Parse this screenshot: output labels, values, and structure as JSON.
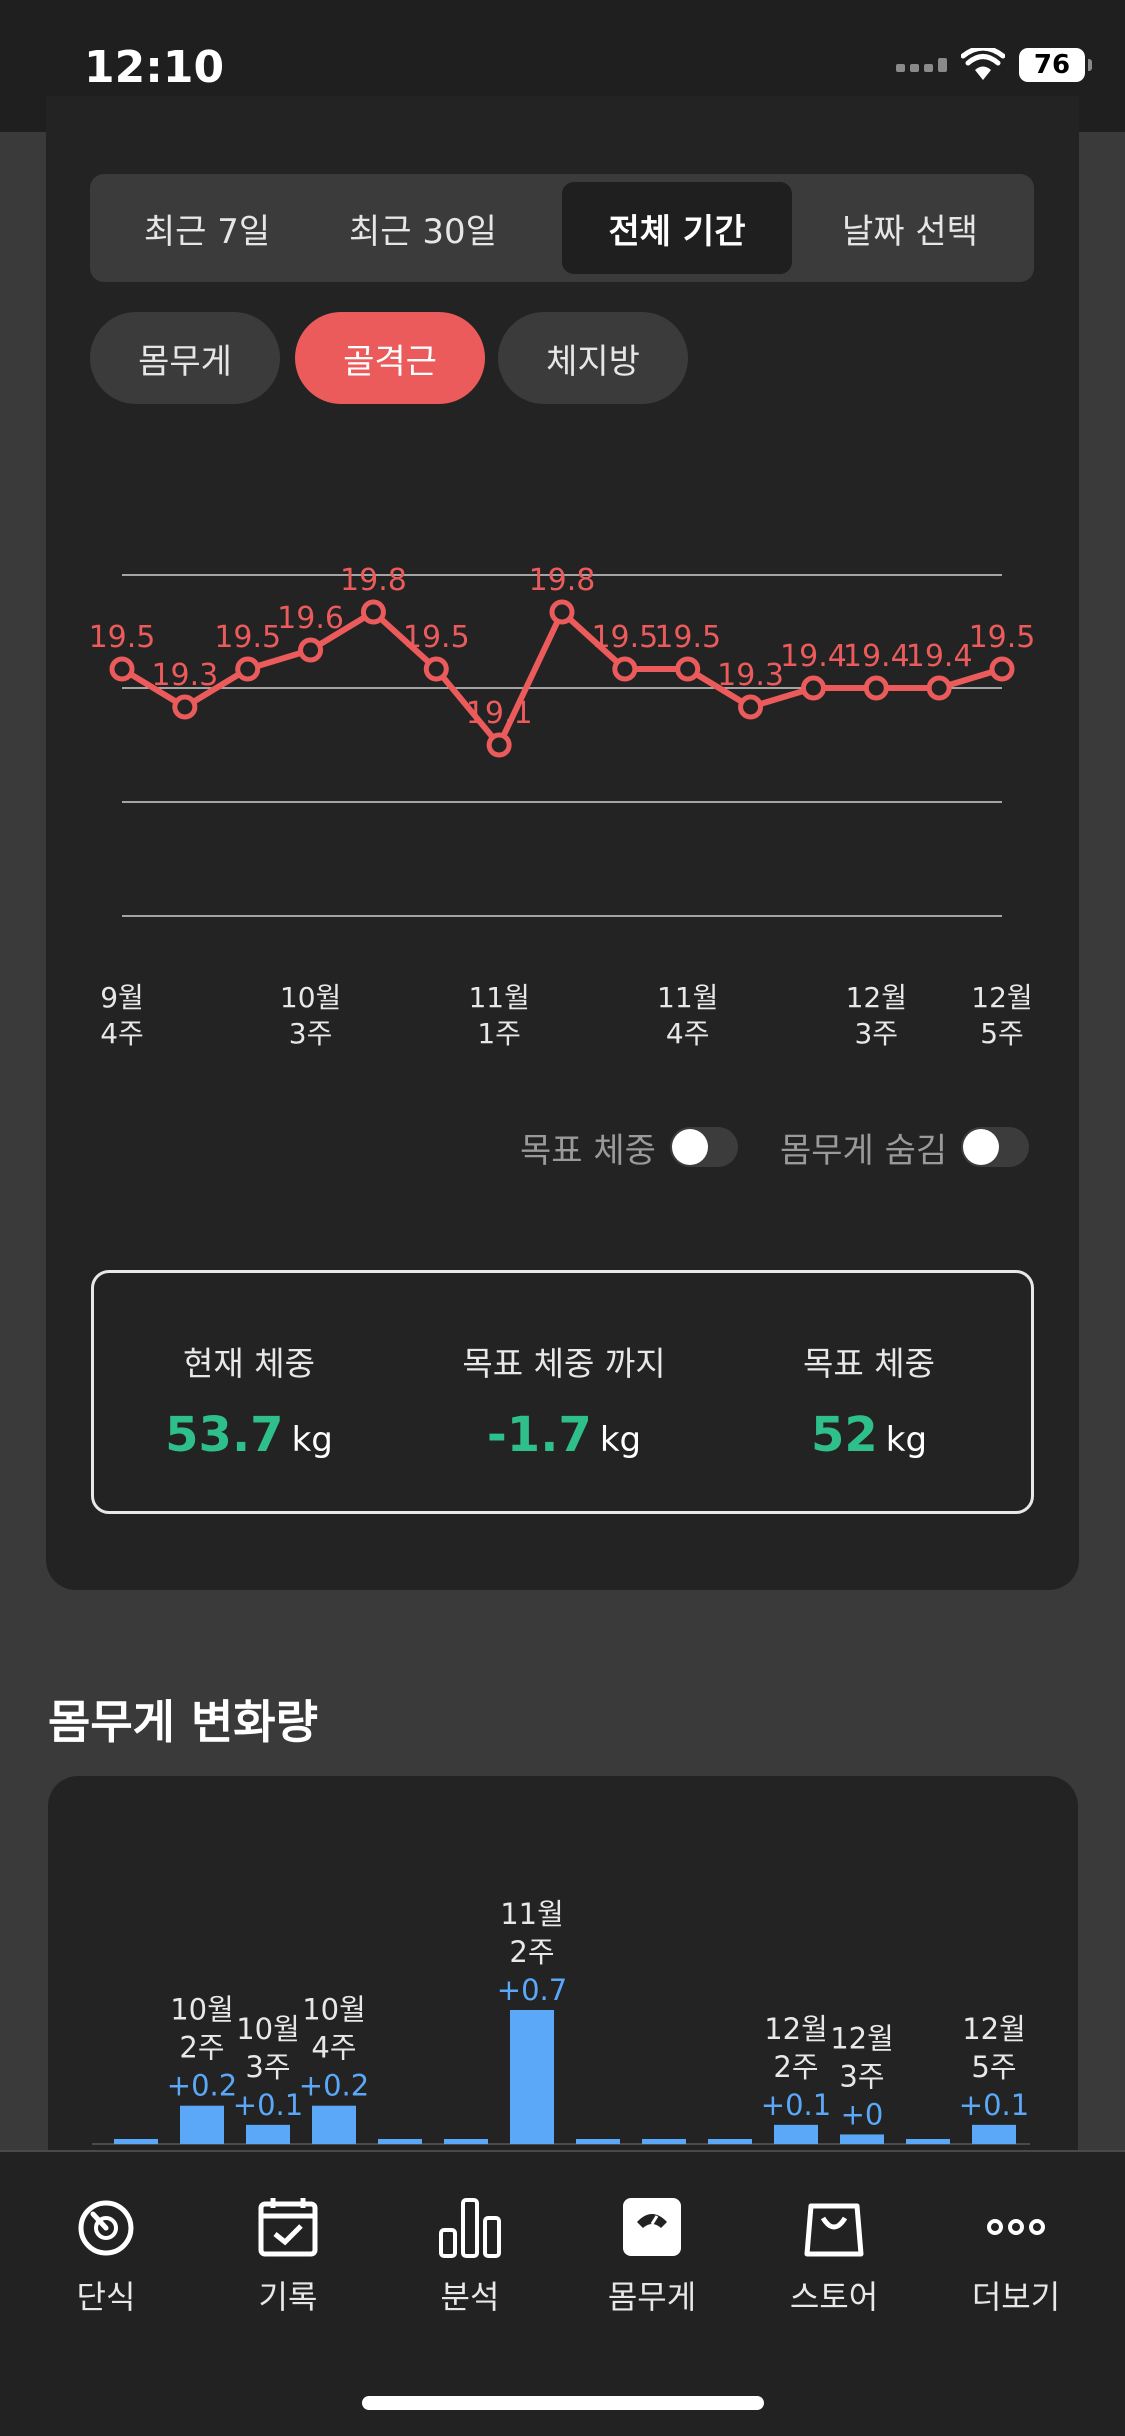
{
  "status_bar": {
    "time": "12:10",
    "battery": "76"
  },
  "period_tabs": [
    {
      "label": "최근 7일",
      "active": false
    },
    {
      "label": "최근 30일",
      "active": false
    },
    {
      "label": "전체 기간",
      "active": true
    },
    {
      "label": "날짜 선택",
      "active": false
    }
  ],
  "metric_chips": [
    {
      "label": "몸무게",
      "active": false
    },
    {
      "label": "골격근",
      "active": true
    },
    {
      "label": "체지방",
      "active": false
    }
  ],
  "chart_data": [
    {
      "type": "line",
      "title": "",
      "xlabel": "",
      "ylabel": "",
      "grid": true,
      "ylim": [
        18.2,
        20.0
      ],
      "x": [
        "9월 4주",
        "",
        "10월 3주",
        "",
        "",
        "11월 1주",
        "",
        "",
        "11월 4주",
        "",
        "",
        "12월 3주",
        "",
        "12월 5주",
        ""
      ],
      "tick_labels": [
        {
          "index": 0,
          "line1": "9월",
          "line2": "4주"
        },
        {
          "index": 3,
          "line1": "10월",
          "line2": "3주"
        },
        {
          "index": 6,
          "line1": "11월",
          "line2": "1주"
        },
        {
          "index": 9,
          "line1": "11월",
          "line2": "4주"
        },
        {
          "index": 12,
          "line1": "12월",
          "line2": "3주"
        },
        {
          "index": 14,
          "line1": "12월",
          "line2": "5주"
        }
      ],
      "series": [
        {
          "color": "#ec5b5b",
          "values": [
            19.5,
            19.3,
            19.5,
            19.6,
            19.8,
            19.5,
            19.1,
            19.8,
            19.5,
            19.5,
            19.3,
            19.4,
            19.4,
            19.4,
            19.5
          ],
          "labels": [
            "19.5",
            "19.3",
            "19.5",
            "19.6",
            "19.8",
            "19.5",
            "19.1",
            "19.8",
            "19.5",
            "19.5",
            "19.3",
            "19.4",
            "19.4",
            "19.4",
            "19.5"
          ]
        }
      ]
    },
    {
      "type": "bar",
      "title": "몸무게 변화량",
      "color": "#5aa8f7",
      "values": [
        0.02,
        0.2,
        0.1,
        0.2,
        0.02,
        0.02,
        0.7,
        0.02,
        0.02,
        0.02,
        0.1,
        0.05,
        0.02,
        0.1
      ],
      "labeled": [
        {
          "index": 1,
          "line1": "10월",
          "line2": "2주",
          "delta": "+0.2"
        },
        {
          "index": 2,
          "line1": "10월",
          "line2": "3주",
          "delta": "+0.1"
        },
        {
          "index": 3,
          "line1": "10월",
          "line2": "4주",
          "delta": "+0.2"
        },
        {
          "index": 6,
          "line1": "11월",
          "line2": "2주",
          "delta": "+0.7"
        },
        {
          "index": 10,
          "line1": "12월",
          "line2": "2주",
          "delta": "+0.1"
        },
        {
          "index": 11,
          "line1": "12월",
          "line2": "3주",
          "delta": "+0"
        },
        {
          "index": 13,
          "line1": "12월",
          "line2": "5주",
          "delta": "+0.1"
        }
      ]
    }
  ],
  "toggles": {
    "goal_weight_label": "목표 체중",
    "hide_weight_label": "몸무게 숨김",
    "goal_weight_on": false,
    "hide_weight_on": false
  },
  "summary": {
    "current": {
      "label": "현재 체중",
      "value": "53.7",
      "unit": "kg"
    },
    "to_goal": {
      "label": "목표 체중 까지",
      "value": "-1.7",
      "unit": "kg"
    },
    "goal": {
      "label": "목표 체중",
      "value": "52",
      "unit": "kg"
    },
    "value_color": "#2fbf8a"
  },
  "section": {
    "title": "몸무게 변화량"
  },
  "tabs": [
    {
      "label": "단식",
      "icon": "timer-icon"
    },
    {
      "label": "기록",
      "icon": "calendar-check-icon"
    },
    {
      "label": "분석",
      "icon": "bar-chart-icon"
    },
    {
      "label": "몸무게",
      "icon": "scale-icon"
    },
    {
      "label": "스토어",
      "icon": "shopping-bag-icon"
    },
    {
      "label": "더보기",
      "icon": "more-icon"
    }
  ]
}
